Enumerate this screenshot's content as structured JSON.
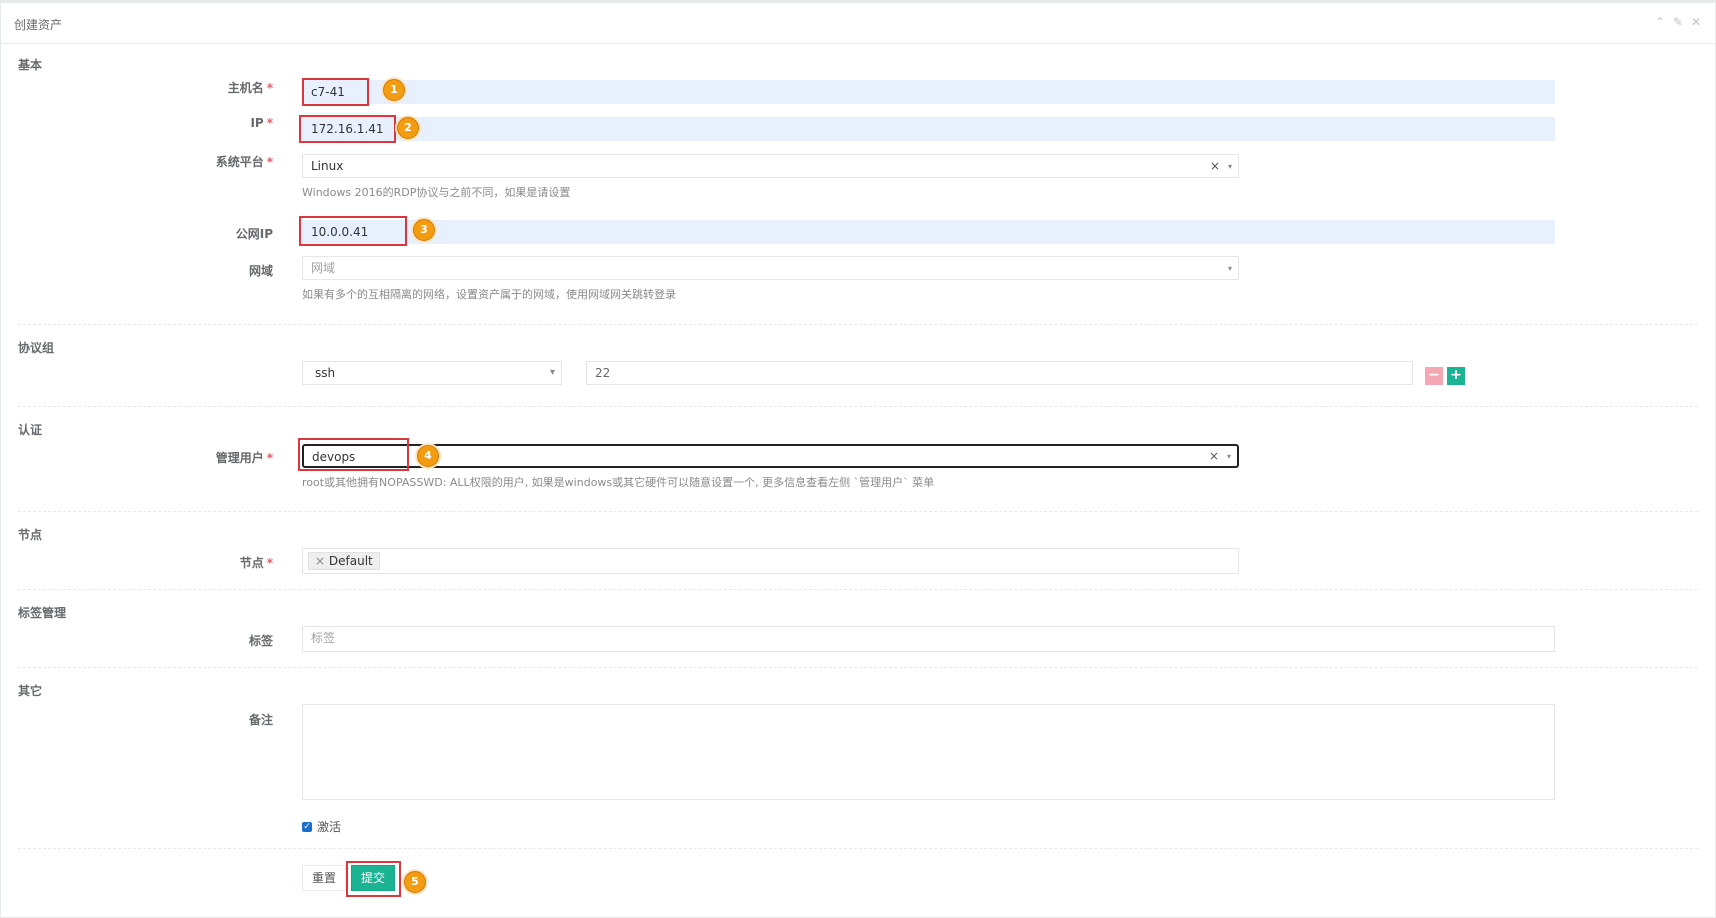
{
  "panel": {
    "title": "创建资产",
    "tools": [
      "⌃",
      "✎",
      "✕"
    ]
  },
  "sections": {
    "basic": "基本",
    "protocol": "协议组",
    "auth": "认证",
    "node": "节点",
    "tags": "标签管理",
    "other": "其它"
  },
  "form": {
    "hostname": {
      "label": "主机名",
      "value": "c7-41"
    },
    "ip": {
      "label": "IP",
      "value": "172.16.1.41"
    },
    "platform": {
      "label": "系统平台",
      "value": "Linux",
      "help": "Windows 2016的RDP协议与之前不同，如果是请设置"
    },
    "public_ip": {
      "label": "公网IP",
      "value": "10.0.0.41"
    },
    "domain": {
      "label": "网域",
      "placeholder": "网域",
      "help": "如果有多个的互相隔离的网络，设置资产属于的网域，使用网域网关跳转登录"
    },
    "protocol": {
      "value": "ssh",
      "port": "22"
    },
    "admin_user": {
      "label": "管理用户",
      "value": "devops",
      "help": "root或其他拥有NOPASSWD: ALL权限的用户, 如果是windows或其它硬件可以随意设置一个, 更多信息查看左侧 `管理用户` 菜单"
    },
    "node": {
      "label": "节点",
      "chip": "Default"
    },
    "labels": {
      "label": "标签",
      "placeholder": "标签"
    },
    "comment": {
      "label": "备注"
    },
    "active": {
      "label": "激活"
    }
  },
  "buttons": {
    "reset": "重置",
    "submit": "提交"
  },
  "required_mark": "*",
  "clear_glyph": "×",
  "caret_glyph": "▾",
  "step_numbers": [
    "1",
    "2",
    "3",
    "4",
    "5"
  ],
  "colors": {
    "accent": "#1ab394",
    "required": "#ed5565",
    "highlight": "#d9363e",
    "step": "#f39c12",
    "autofill": "#e8f0fe"
  }
}
